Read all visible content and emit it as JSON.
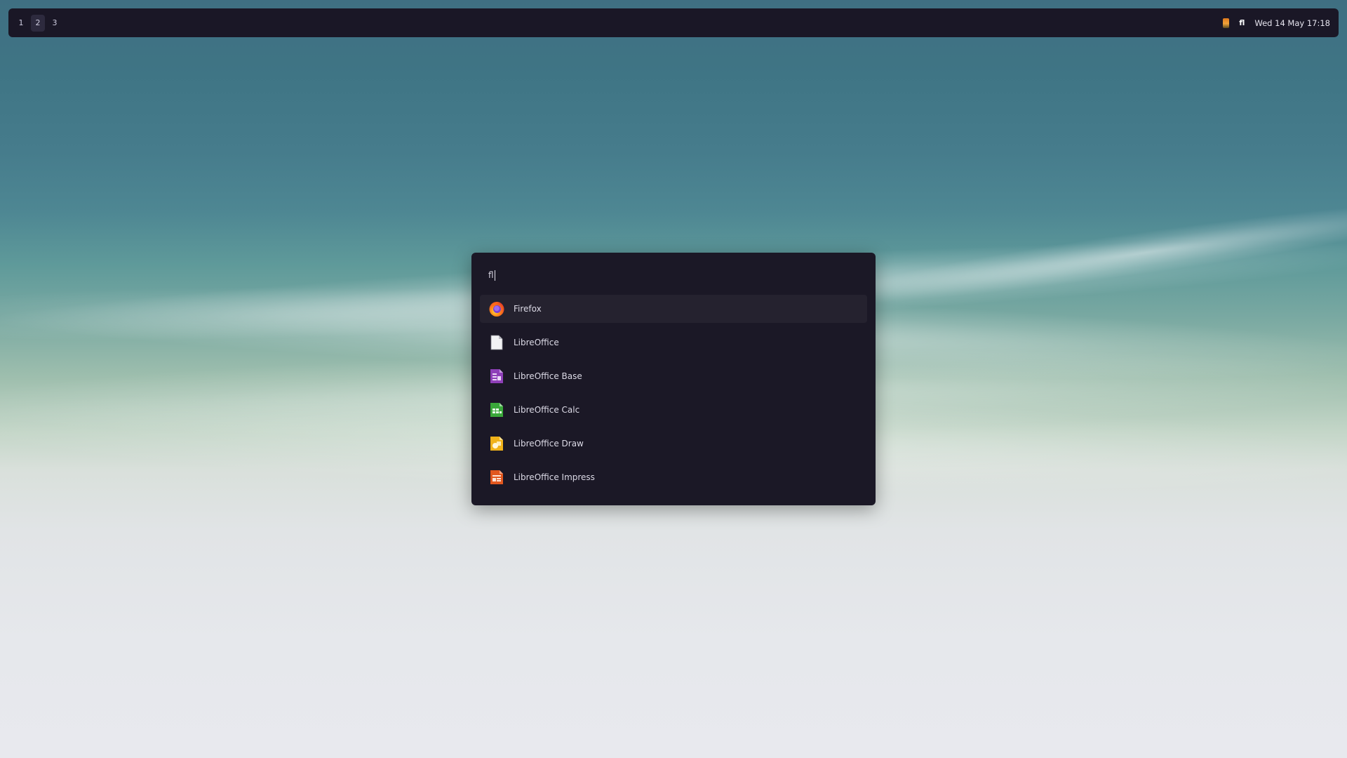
{
  "workspaces": [
    {
      "label": "1",
      "active": false
    },
    {
      "label": "2",
      "active": true
    },
    {
      "label": "3",
      "active": false
    }
  ],
  "tray": {
    "indicator_label": "fl",
    "clock": "Wed 14 May 17:18"
  },
  "launcher": {
    "query": "fl",
    "results": [
      {
        "label": "Firefox",
        "icon": "firefox-icon",
        "selected": true
      },
      {
        "label": "LibreOffice",
        "icon": "libreoffice-icon",
        "selected": false
      },
      {
        "label": "LibreOffice Base",
        "icon": "libreoffice-base-icon",
        "selected": false
      },
      {
        "label": "LibreOffice Calc",
        "icon": "libreoffice-calc-icon",
        "selected": false
      },
      {
        "label": "LibreOffice Draw",
        "icon": "libreoffice-draw-icon",
        "selected": false
      },
      {
        "label": "LibreOffice Impress",
        "icon": "libreoffice-impress-icon",
        "selected": false
      }
    ]
  },
  "colors": {
    "bar_bg": "#1a1726",
    "launcher_bg": "#1b1826",
    "selected_bg": "#25222f",
    "text": "#dcdae6"
  }
}
